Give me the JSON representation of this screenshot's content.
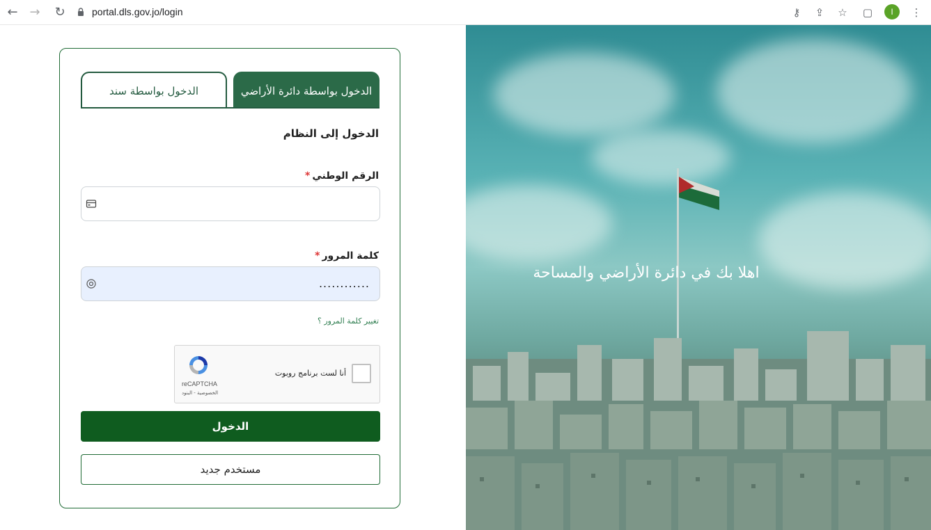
{
  "browser": {
    "url": "portal.dls.gov.jo/login",
    "profile_initial": "I"
  },
  "hero": {
    "welcome": "اهلا بك في دائرة الأراضي والمساحة"
  },
  "login": {
    "tabs": [
      {
        "label": "الدخول بواسطة دائرة الأراضي",
        "active": true
      },
      {
        "label": "الدخول بواسطة سند",
        "active": false
      }
    ],
    "heading": "الدخول إلى النظام",
    "national_id": {
      "label": "الرقم الوطني",
      "required_mark": "*",
      "value": ""
    },
    "password": {
      "label": "كلمة المرور",
      "required_mark": "*",
      "value": "............"
    },
    "change_password_link": "تغيير كلمة المرور ؟",
    "captcha": {
      "label": "أنا لست برنامج روبوت",
      "brand": "reCAPTCHA",
      "links": "الخصوصية - البنود"
    },
    "submit_label": "الدخول",
    "new_user_label": "مستخدم جديد"
  },
  "colors": {
    "primary_green": "#0f5c1f",
    "tab_green": "#2b6a48"
  }
}
